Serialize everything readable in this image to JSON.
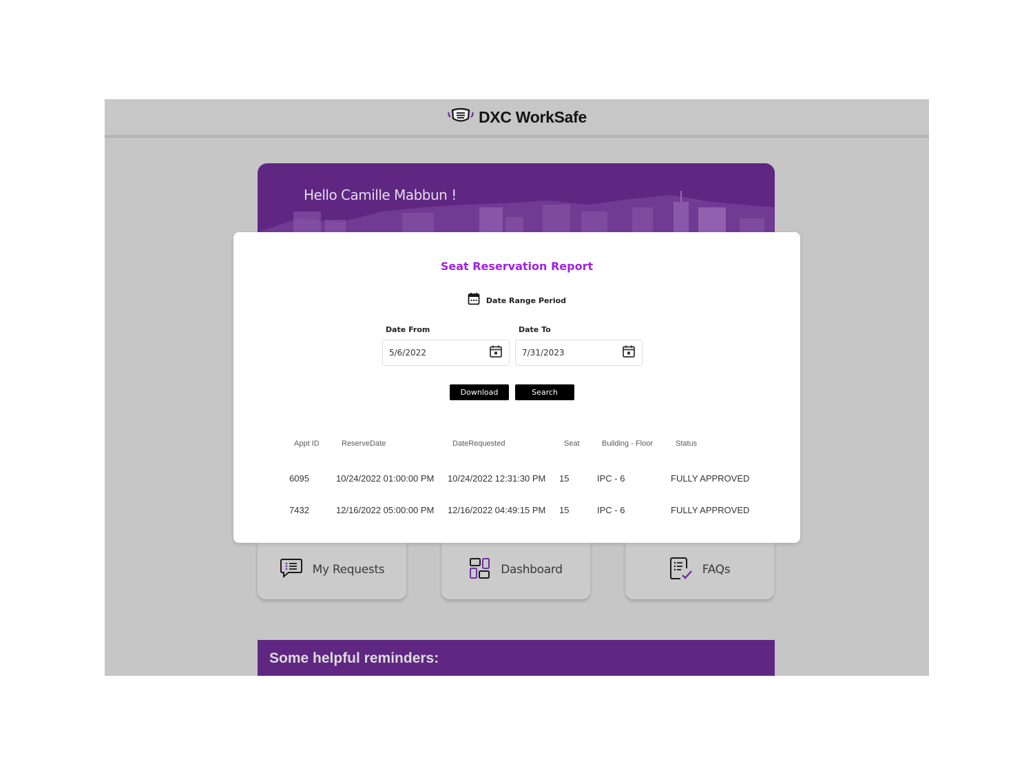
{
  "header": {
    "app_title": "DXC WorkSafe",
    "logo_icon": "face-mask-icon"
  },
  "hero": {
    "greeting": "Hello Camille Mabbun !"
  },
  "cards": [
    {
      "label": "My Requests",
      "icon": "chat-list-icon"
    },
    {
      "label": "Dashboard",
      "icon": "dashboard-grid-icon"
    },
    {
      "label": "FAQs",
      "icon": "checklist-doc-icon"
    }
  ],
  "reminders": {
    "title": "Some helpful reminders:"
  },
  "modal": {
    "title": "Seat Reservation Report",
    "date_range_label": "Date Range Period",
    "date_from_label": "Date From",
    "date_from_value": "5/6/2022",
    "date_to_label": "Date To",
    "date_to_value": "7/31/2023",
    "download_label": "Download",
    "search_label": "Search"
  },
  "table": {
    "headers": [
      "Appt ID",
      "ReserveDate",
      "DateRequested",
      "Seat",
      "Building - Floor",
      "Status"
    ],
    "rows": [
      [
        "6095",
        "10/24/2022 01:00:00 PM",
        "10/24/2022 12:31:30 PM",
        "15",
        "IPC - 6",
        "FULLY APPROVED"
      ],
      [
        "7432",
        "12/16/2022 05:00:00 PM",
        "12/16/2022 04:49:15 PM",
        "15",
        "IPC - 6",
        "FULLY APPROVED"
      ]
    ]
  },
  "colors": {
    "brand_purple": "#5f2682",
    "title_purple": "#a021e6",
    "backdrop": "#c6c6c6"
  }
}
